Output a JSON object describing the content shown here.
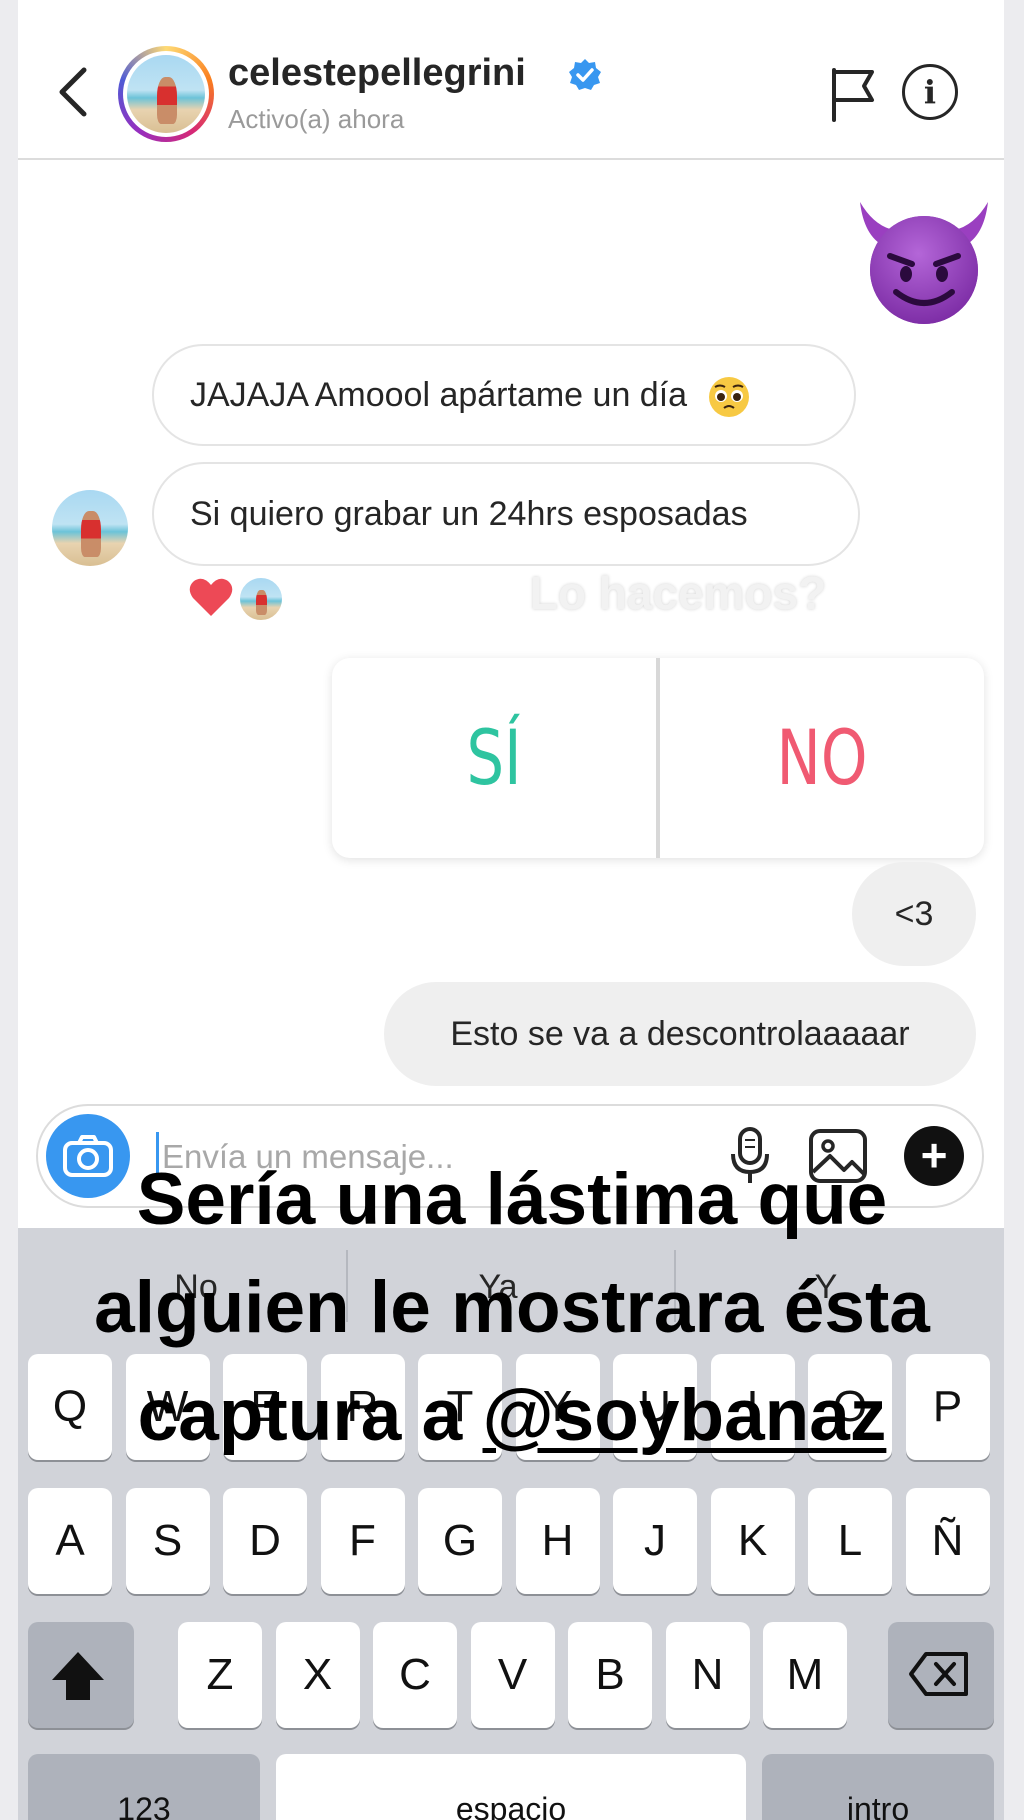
{
  "header": {
    "username": "celestepellegrini",
    "status": "Activo(a) ahora"
  },
  "icons": {
    "back": "chevron-left-icon",
    "verified": "verified-badge-icon",
    "flag": "flag-icon",
    "info": "info-icon",
    "camera": "camera-icon",
    "mic": "microphone-icon",
    "gallery": "image-icon",
    "plus": "plus-icon",
    "shift": "shift-icon",
    "backspace": "backspace-icon",
    "reaction": "heart-icon",
    "sticker": "smiling-devil-emoji",
    "pleading": "pleading-face-emoji"
  },
  "messages": [
    {
      "from": "them",
      "text": "JAJAJA Amoool apártame un día"
    },
    {
      "from": "them",
      "text": "Si quiero grabar un 24hrs esposadas"
    },
    {
      "from": "me",
      "text": "<3"
    },
    {
      "from": "me",
      "text": "Esto se va a descontrolaaaaar"
    }
  ],
  "poll": {
    "question": "Lo hacemos?",
    "option_yes": "SÍ",
    "option_no": "NO"
  },
  "composer": {
    "placeholder": "Envía un mensaje..."
  },
  "keyboard": {
    "suggestions": [
      "No",
      "Ya",
      "Y"
    ],
    "row1": [
      "Q",
      "W",
      "E",
      "R",
      "T",
      "Y",
      "U",
      "I",
      "O",
      "P"
    ],
    "row2": [
      "A",
      "S",
      "D",
      "F",
      "G",
      "H",
      "J",
      "K",
      "L",
      "Ñ"
    ],
    "row3": [
      "Z",
      "X",
      "C",
      "V",
      "B",
      "N",
      "M"
    ],
    "numbers": "123",
    "space": "espacio",
    "return": "intro"
  },
  "overlay": {
    "line1": "Sería una lástima que",
    "line2": "alguien le mostrara ésta",
    "line3_prefix": "captura a ",
    "mention": "@soybanaz"
  },
  "colors": {
    "accent_blue": "#3897f0",
    "poll_yes": "#2ec4a0",
    "poll_no": "#f05a72",
    "heart": "#ed4956"
  }
}
